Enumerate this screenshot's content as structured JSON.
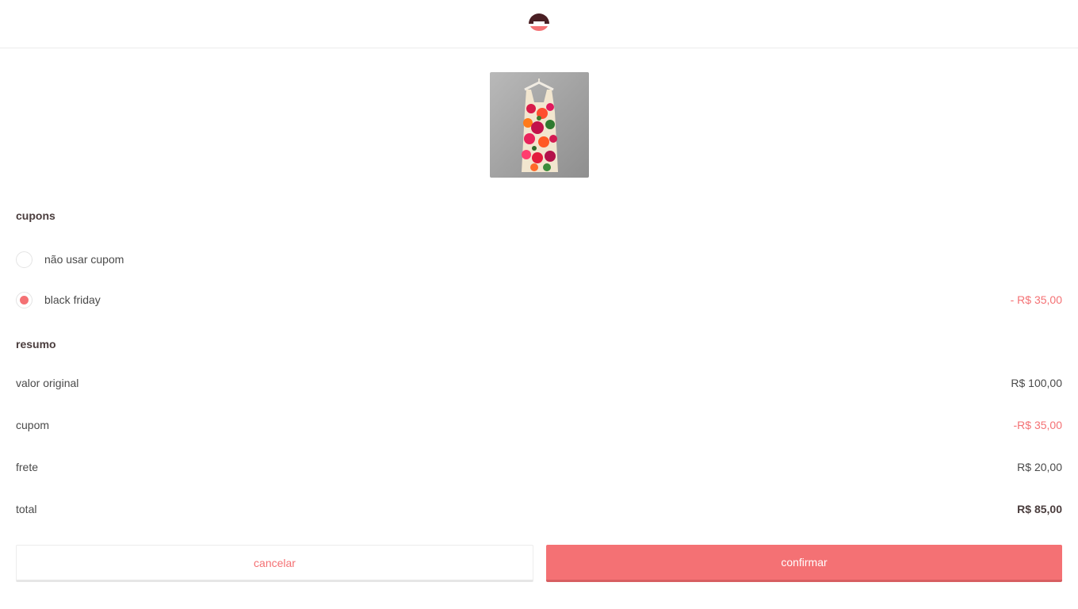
{
  "header": {
    "logo_icon": "brand-e-logo"
  },
  "product": {
    "image_icon": "floral-dress-photo"
  },
  "coupons": {
    "title": "cupons",
    "options": [
      {
        "label": "não usar cupom",
        "discount": "",
        "selected": false
      },
      {
        "label": "black friday",
        "discount": "- R$ 35,00",
        "selected": true
      }
    ]
  },
  "summary": {
    "title": "resumo",
    "rows": [
      {
        "label": "valor original",
        "value": "R$ 100,00"
      },
      {
        "label": "cupom",
        "value": "-R$ 35,00"
      },
      {
        "label": "frete",
        "value": "R$ 20,00"
      },
      {
        "label": "total",
        "value": "R$ 85,00"
      }
    ]
  },
  "actions": {
    "cancel_label": "cancelar",
    "confirm_label": "confirmar"
  },
  "colors": {
    "accent": "#f47174",
    "text": "#4a4a4a",
    "heading": "#4a3d3d",
    "logo_dark": "#4a1f24"
  }
}
